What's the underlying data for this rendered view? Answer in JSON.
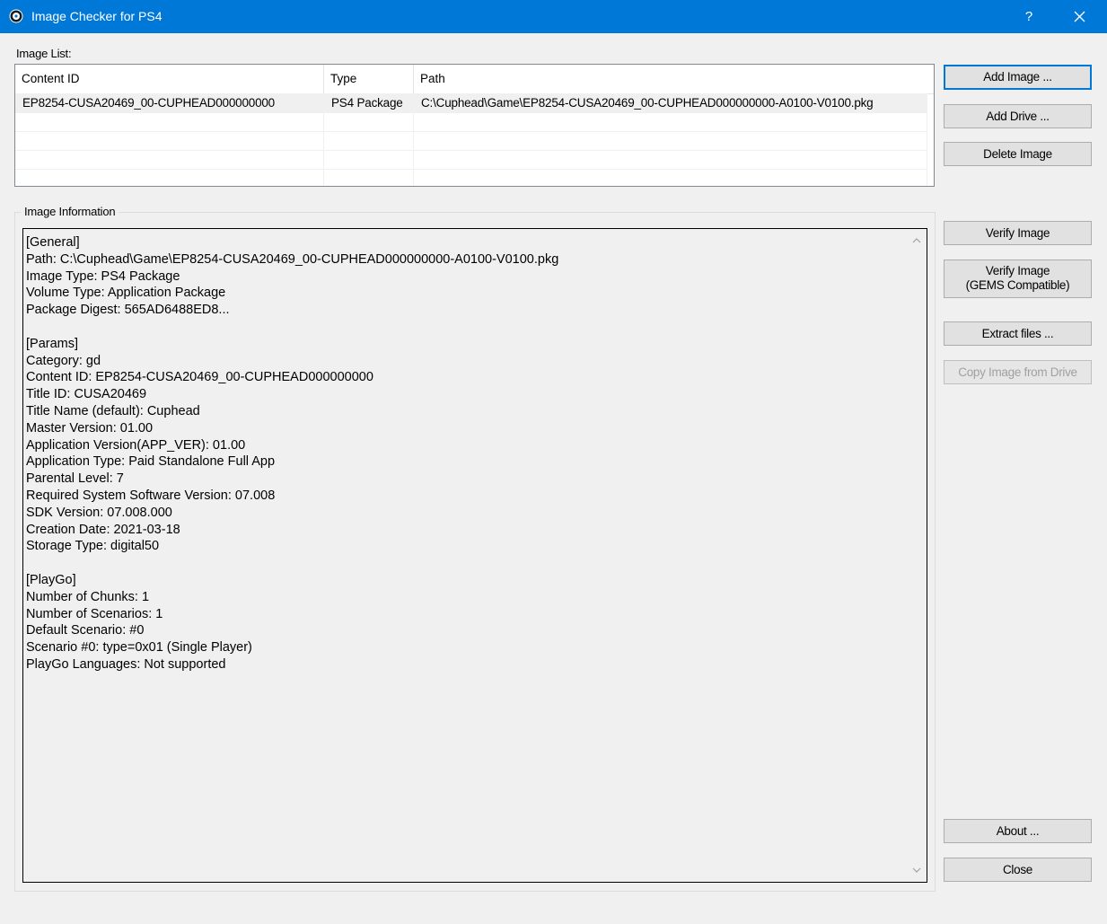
{
  "window": {
    "title": "Image Checker for PS4",
    "help_label": "?"
  },
  "image_list": {
    "label": "Image List:",
    "columns": [
      "Content ID",
      "Type",
      "Path"
    ],
    "rows": [
      [
        "EP8254-CUSA20469_00-CUPHEAD000000000",
        "PS4 Package",
        "C:\\Cuphead\\Game\\EP8254-CUSA20469_00-CUPHEAD000000000-A0100-V0100.pkg"
      ]
    ]
  },
  "image_info": {
    "legend": "Image Information",
    "text": "[General]\nPath: C:\\Cuphead\\Game\\EP8254-CUSA20469_00-CUPHEAD000000000-A0100-V0100.pkg\nImage Type: PS4 Package\nVolume Type: Application Package\nPackage Digest: 565AD6488ED8...\n\n[Params]\nCategory: gd\nContent ID: EP8254-CUSA20469_00-CUPHEAD000000000\nTitle ID: CUSA20469\nTitle Name (default): Cuphead\nMaster Version: 01.00\nApplication Version(APP_VER): 01.00\nApplication Type: Paid Standalone Full App\nParental Level: 7\nRequired System Software Version: 07.008\nSDK Version: 07.008.000\nCreation Date: 2021-03-18\nStorage Type: digital50\n\n[PlayGo]\nNumber of Chunks: 1\nNumber of Scenarios: 1\nDefault Scenario: #0\nScenario #0: type=0x01 (Single Player)\nPlayGo Languages: Not supported"
  },
  "buttons": {
    "add_image": "Add Image ...",
    "add_drive": "Add Drive ...",
    "delete_image": "Delete Image",
    "verify_image": "Verify Image",
    "verify_gems_line1": "Verify Image",
    "verify_gems_line2": "(GEMS Compatible)",
    "extract_files": "Extract files ...",
    "copy_from_drive": "Copy Image from Drive",
    "about": "About ...",
    "close": "Close"
  },
  "colors": {
    "titlebar": "#0078d7",
    "background": "#f0f0f0",
    "default_button_border": "#0078d7"
  }
}
